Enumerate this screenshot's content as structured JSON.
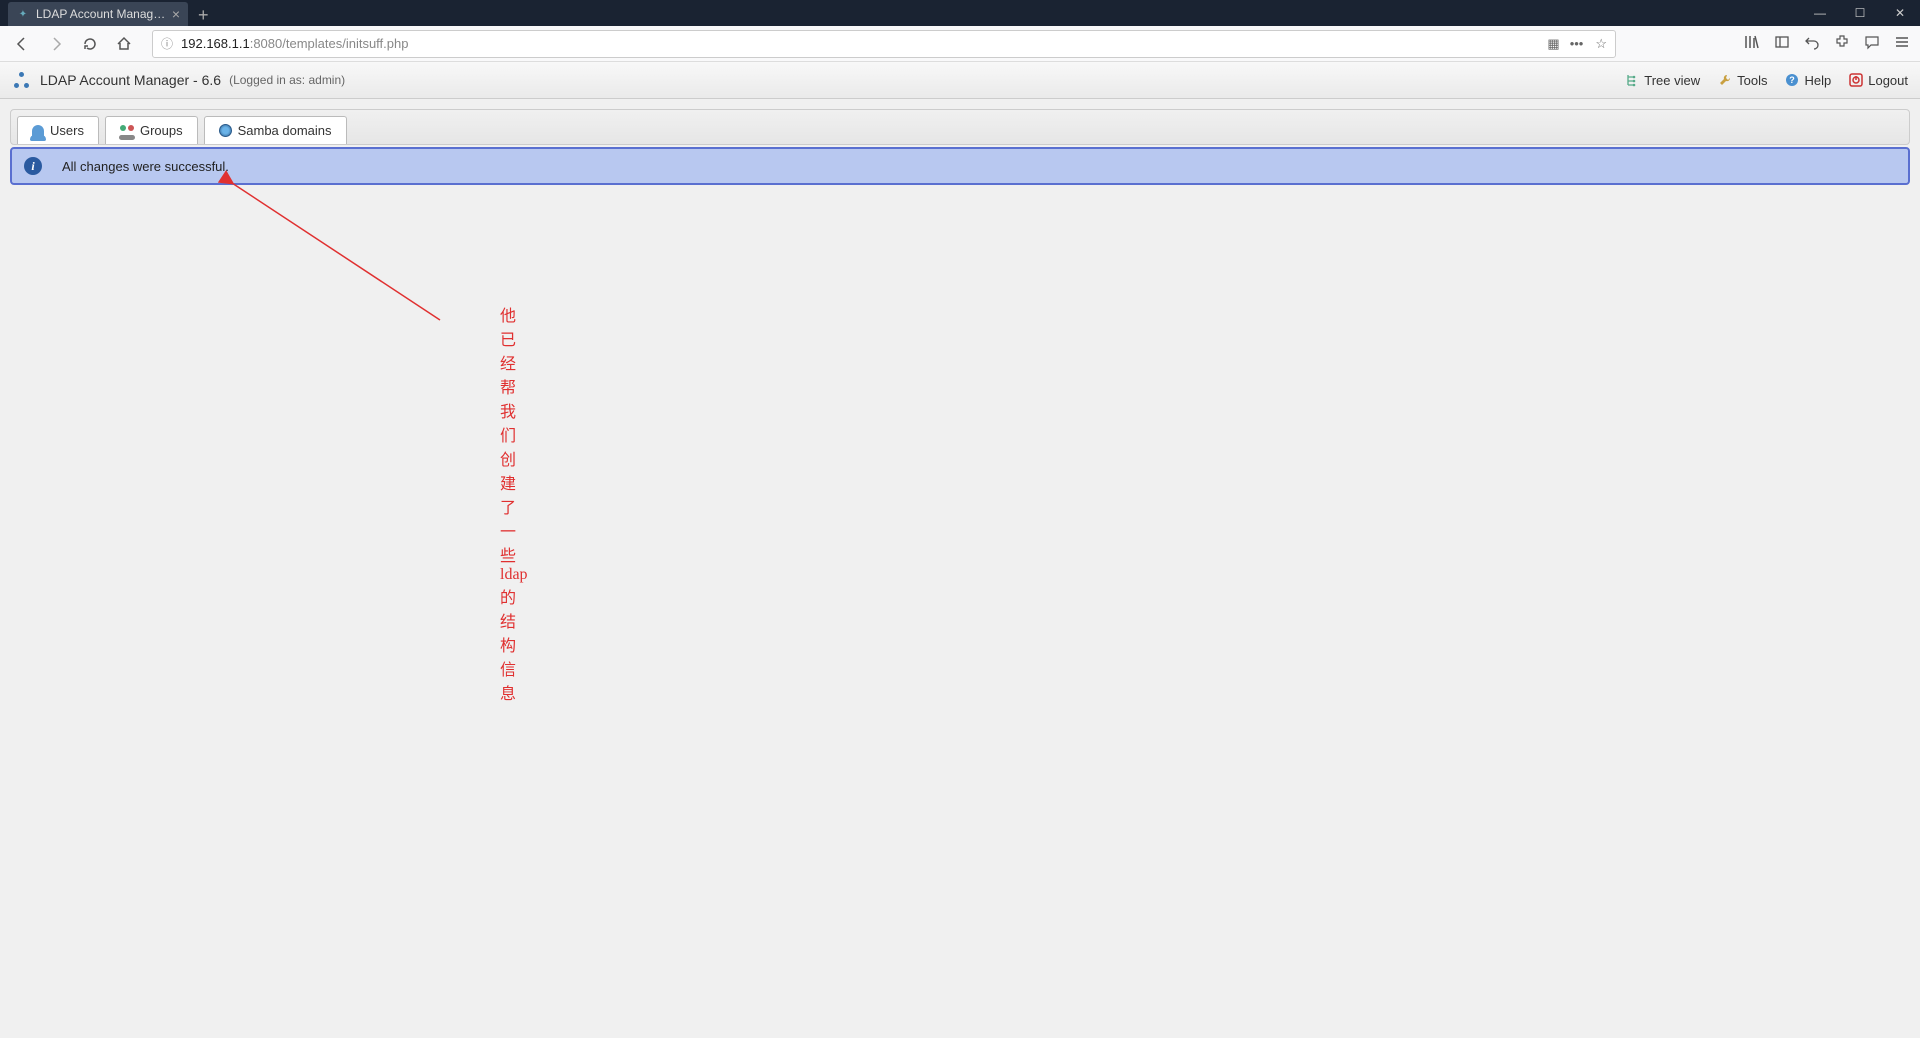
{
  "browser": {
    "tab_title": "LDAP Account Manager (ope",
    "url_host": "192.168.1.1",
    "url_rest": ":8080/templates/initsuff.php"
  },
  "header": {
    "app_title": "LDAP Account Manager - 6.6",
    "login_info": "(Logged in as: admin)",
    "links": {
      "tree_view": "Tree view",
      "tools": "Tools",
      "help": "Help",
      "logout": "Logout"
    }
  },
  "tabs": {
    "users": "Users",
    "groups": "Groups",
    "samba": "Samba domains"
  },
  "message": "All changes were successful.",
  "annotation": "他已经帮我们创建了一些ldap的结构信息"
}
